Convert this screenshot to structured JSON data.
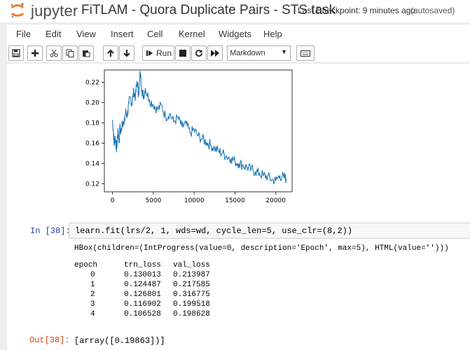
{
  "header": {
    "logo_text": "jupyter",
    "title": "FiTLAM - Quora Duplicate Pairs - STS task",
    "checkpoint": "Last Checkpoint: 9 minutes ago",
    "autosaved": "(autosaved)"
  },
  "menu": [
    "File",
    "Edit",
    "View",
    "Insert",
    "Cell",
    "Kernel",
    "Widgets",
    "Help"
  ],
  "toolbar": {
    "run_label": "Run",
    "cell_type": "Markdown",
    "icons": [
      "save-icon",
      "plus-icon",
      "scissors-icon",
      "copy-icon",
      "paste-icon",
      "arrow-up-icon",
      "arrow-down-icon",
      "step-forward-icon",
      "stop-icon",
      "restart-icon",
      "fast-forward-icon",
      "keyboard-icon"
    ]
  },
  "chart_data": {
    "type": "line",
    "title": "",
    "xlabel": "",
    "ylabel": "",
    "xlim": [
      -1000,
      22000
    ],
    "ylim": [
      0.112,
      0.232
    ],
    "xticks": [
      0,
      5000,
      10000,
      15000,
      20000
    ],
    "yticks": [
      0.12,
      0.14,
      0.16,
      0.18,
      0.2,
      0.22
    ],
    "xtick_labels": [
      "0",
      "5000",
      "10000",
      "15000",
      "20000"
    ],
    "ytick_labels": [
      "0.12",
      "0.14",
      "0.16",
      "0.18",
      "0.20",
      "0.22"
    ],
    "line_color": "#1f77b4",
    "series": [
      {
        "x": [
          0,
          100,
          200,
          300,
          400,
          500,
          600,
          700,
          800,
          900,
          1000,
          1200,
          1400,
          1600,
          1800,
          2000,
          2200,
          2400,
          2600,
          2800,
          3000,
          3200,
          3400,
          3600,
          3800,
          4000,
          4500,
          5000,
          5500,
          6000,
          6500,
          7000,
          7500,
          8000,
          8500,
          9000,
          9500,
          10000,
          10500,
          11000,
          11500,
          12000,
          12500,
          13000,
          13500,
          14000,
          14500,
          15000,
          15500,
          16000,
          16500,
          17000,
          17500,
          18000,
          18500,
          19000,
          19500,
          20000,
          20500,
          21000,
          21300
        ],
        "y": [
          0.183,
          0.172,
          0.158,
          0.167,
          0.161,
          0.154,
          0.166,
          0.171,
          0.16,
          0.176,
          0.169,
          0.182,
          0.178,
          0.191,
          0.187,
          0.199,
          0.205,
          0.198,
          0.212,
          0.205,
          0.221,
          0.208,
          0.23,
          0.212,
          0.206,
          0.214,
          0.203,
          0.198,
          0.193,
          0.197,
          0.186,
          0.189,
          0.181,
          0.185,
          0.176,
          0.179,
          0.17,
          0.173,
          0.167,
          0.164,
          0.161,
          0.158,
          0.155,
          0.152,
          0.15,
          0.147,
          0.145,
          0.142,
          0.14,
          0.138,
          0.136,
          0.134,
          0.132,
          0.13,
          0.128,
          0.127,
          0.124,
          0.123,
          0.128,
          0.126,
          0.125
        ]
      }
    ]
  },
  "cell": {
    "prompt_in": "In [38]:",
    "code": "learn.fit(lrs/2, 1, wds=wd, cycle_len=5, use_clr=(8,2))",
    "hbox": "HBox(children=(IntProgress(value=0, description='Epoch', max=5), HTML(value='')))",
    "table": {
      "headers": [
        "epoch",
        "trn_loss",
        "val_loss"
      ],
      "rows": [
        [
          "0",
          "0.130013",
          "0.213987"
        ],
        [
          "1",
          "0.124487",
          "0.217585"
        ],
        [
          "2",
          "0.126801",
          "0.316775"
        ],
        [
          "3",
          "0.116902",
          "0.199518"
        ],
        [
          "4",
          "0.106528",
          "0.198628"
        ]
      ]
    },
    "prompt_out": "Out[38]:",
    "output": "[array([0.19863])]"
  }
}
